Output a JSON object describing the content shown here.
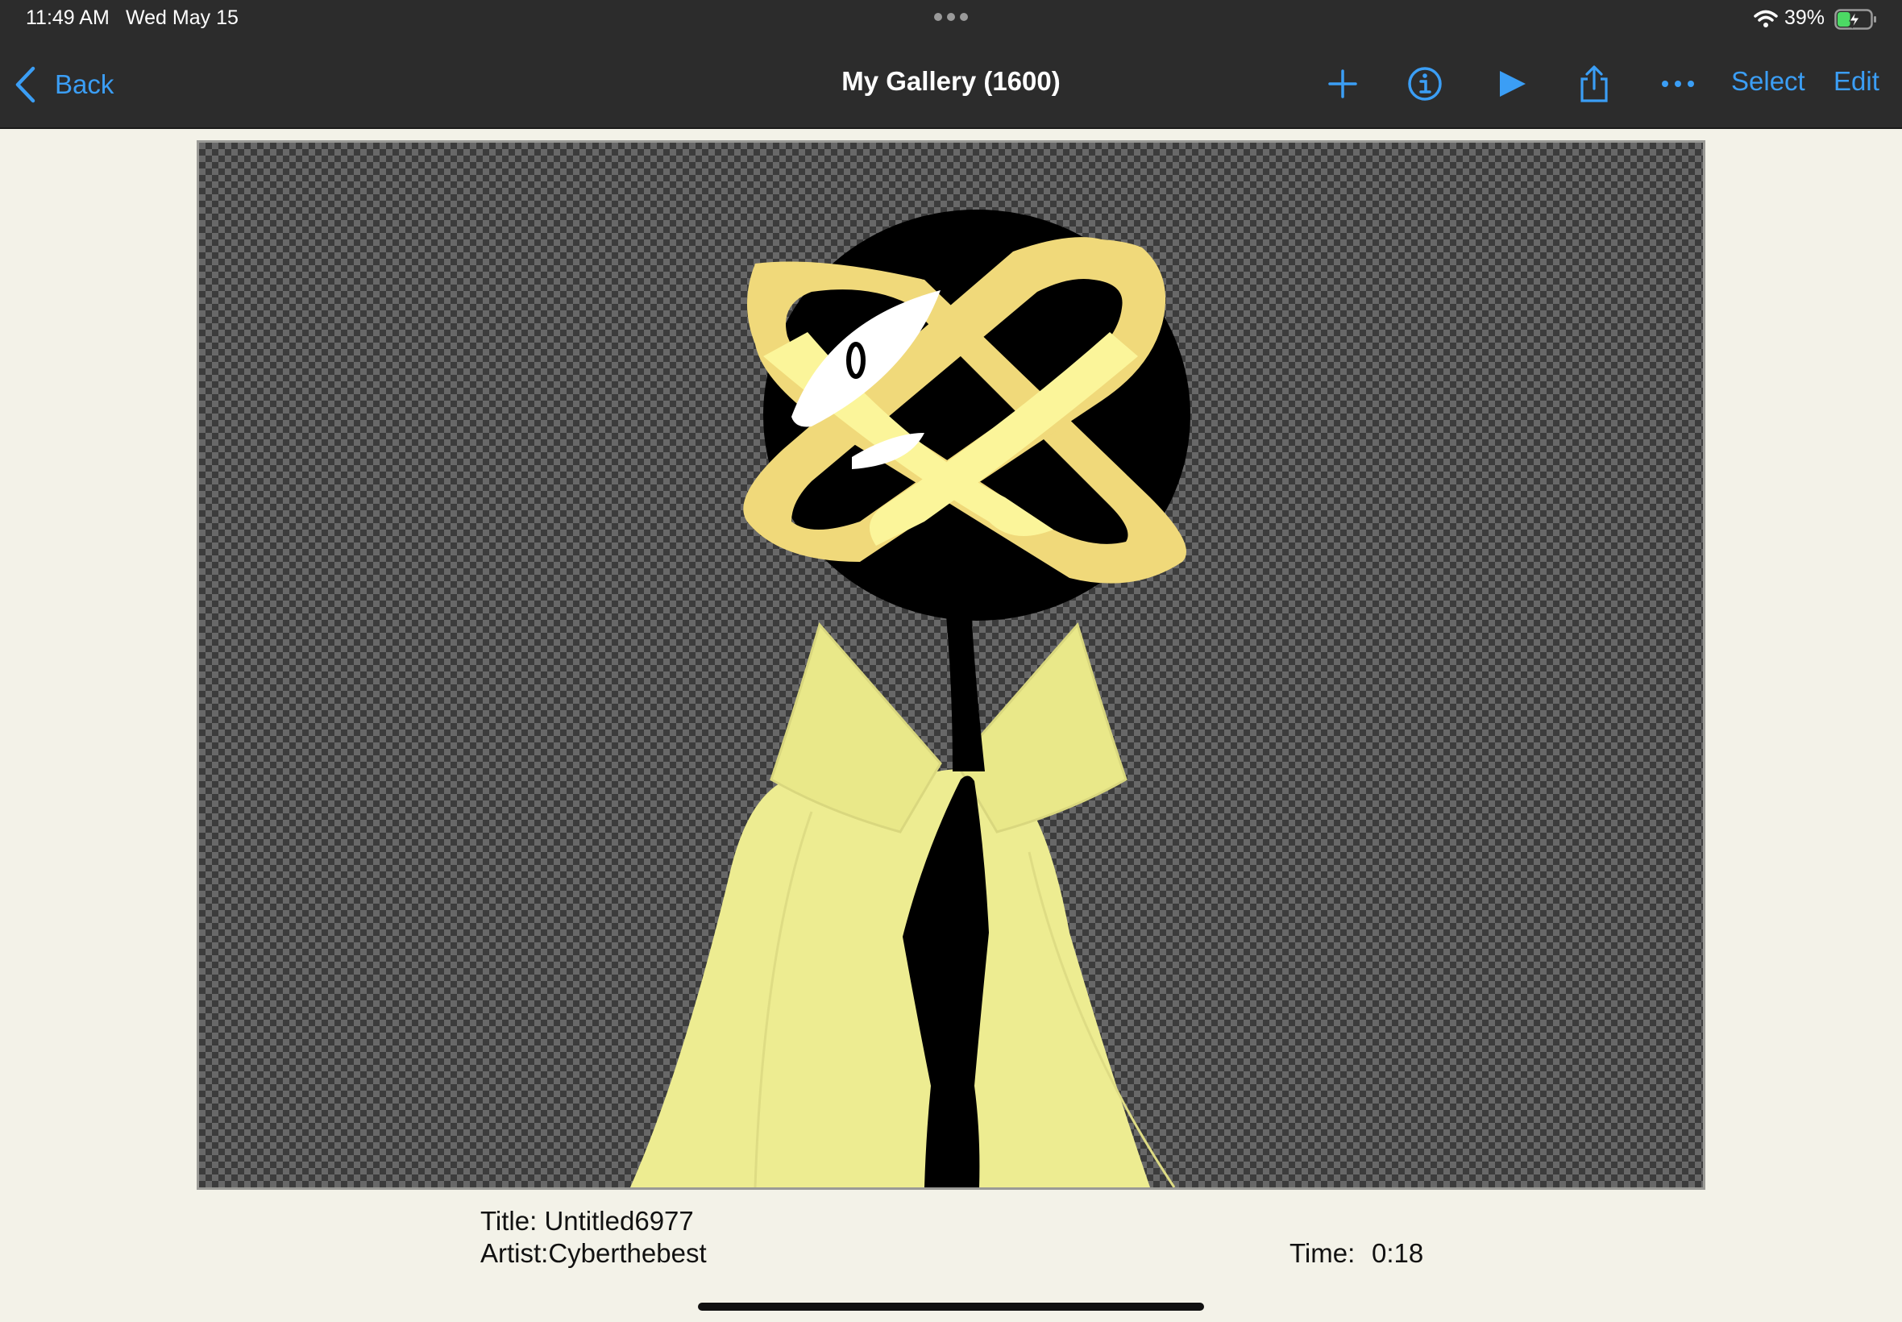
{
  "status_bar": {
    "time": "11:49 AM",
    "date": "Wed May 15",
    "battery_percent": "39%",
    "battery_level": 0.39,
    "charging": true
  },
  "nav_bar": {
    "back_label": "Back",
    "title": "My Gallery (1600)",
    "icons": [
      "plus-icon",
      "info-icon",
      "play-icon",
      "share-icon",
      "more-icon"
    ],
    "select_label": "Select",
    "edit_label": "Edit",
    "accent_color": "#3b9ef5",
    "bar_color": "#2c2c2c"
  },
  "artwork": {
    "background": "transparency-checkerboard",
    "palette": {
      "figure": "#000000",
      "coat": "#edec91",
      "ring": "#f0d97a",
      "ring_highlight": "#fbf59a",
      "eye": "#ffffff"
    }
  },
  "details": {
    "title": "Title: Untitled6977",
    "artist": "Artist:Cyberthebest",
    "time_label": "Time:",
    "time_value": "0:18"
  }
}
